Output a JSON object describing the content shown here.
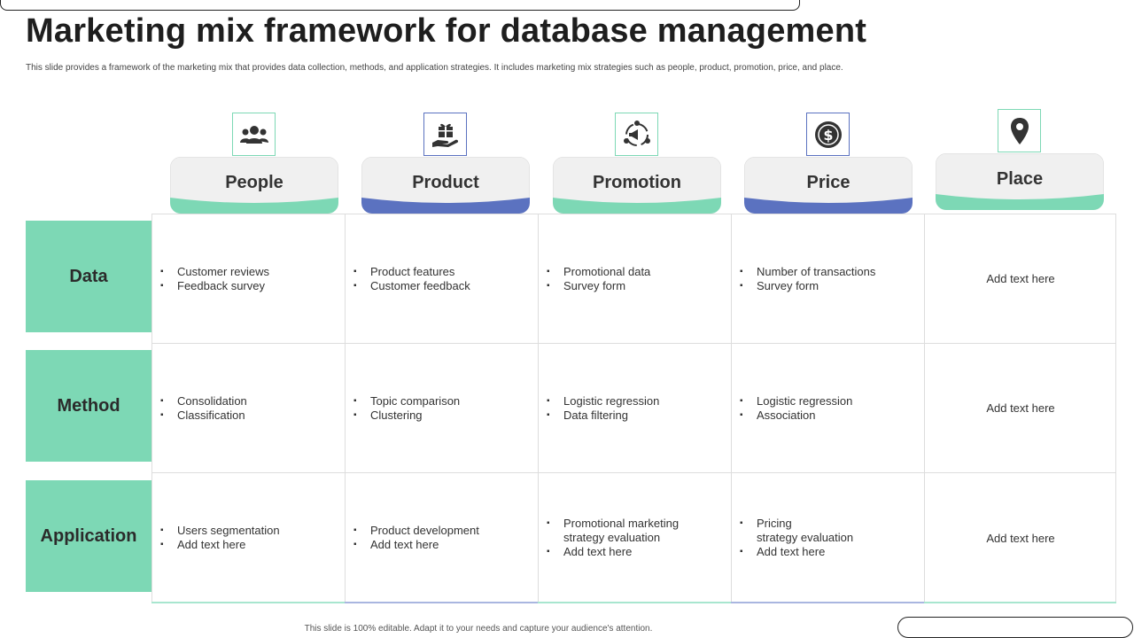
{
  "title": "Marketing mix framework for database management",
  "subtitle": "This slide provides a framework of the marketing mix that provides data collection, methods, and application strategies. It includes marketing mix strategies such as people, product, promotion, price, and place.",
  "columns": [
    {
      "label": "People",
      "icon": "people-group-icon",
      "accent": "#7dd8b5"
    },
    {
      "label": "Product",
      "icon": "gift-hand-icon",
      "accent": "#5b72c0"
    },
    {
      "label": "Promotion",
      "icon": "megaphone-cycle-icon",
      "accent": "#7dd8b5"
    },
    {
      "label": "Price",
      "icon": "dollar-coin-icon",
      "accent": "#5b72c0"
    },
    {
      "label": "Place",
      "icon": "location-pin-icon",
      "accent": "#7dd8b5"
    }
  ],
  "rows": [
    {
      "label": "Data"
    },
    {
      "label": "Method"
    },
    {
      "label": "Application"
    }
  ],
  "cells": {
    "data": {
      "people": [
        "Customer reviews",
        "Feedback survey"
      ],
      "product": [
        "Product features",
        "Customer feedback"
      ],
      "promotion": [
        "Promotional data",
        "Survey form"
      ],
      "price": [
        "Number of transactions",
        "Survey form"
      ],
      "place": "Add text here"
    },
    "method": {
      "people": [
        "Consolidation",
        "Classification"
      ],
      "product": [
        "Topic comparison",
        "Clustering"
      ],
      "promotion": [
        "Logistic regression",
        "Data filtering"
      ],
      "price": [
        "Logistic regression",
        "Association"
      ],
      "place": "Add text here"
    },
    "application": {
      "people": [
        "Users segmentation",
        "Add text here"
      ],
      "product": [
        "Product development",
        "Add text here"
      ],
      "promotion": [
        "Promotional marketing",
        "strategy evaluation",
        "Add text here"
      ],
      "price": [
        "Pricing",
        "strategy evaluation",
        "Add text here"
      ],
      "place": "Add text here"
    }
  },
  "footer": "This slide is 100% editable. Adapt it to your needs and capture your audience's attention.",
  "colors": {
    "green": "#7dd8b5",
    "blue": "#5b72c0",
    "tab_gray": "#f0f0f0"
  }
}
